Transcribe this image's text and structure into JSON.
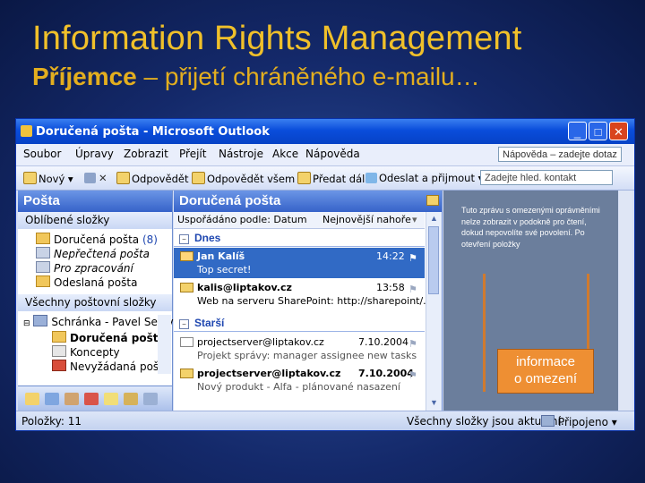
{
  "slide": {
    "title": "Information Rights Management",
    "subtitle_bold": "Příjemce",
    "subtitle_rest": " – přijetí chráněného e-mailu…"
  },
  "window": {
    "title": "Doručená pošta - Microsoft Outlook",
    "menu": [
      "Soubor",
      "Úpravy",
      "Zobrazit",
      "Přejít",
      "Nástroje",
      "Akce",
      "Nápověda"
    ],
    "help_placeholder": "Nápověda – zadejte dotaz",
    "toolbar": {
      "new": "Nový",
      "reply": "Odpovědět",
      "reply_all": "Odpovědět všem",
      "forward": "Předat dál",
      "send_receive": "Odeslat a přijmout",
      "search_placeholder": "Zadejte hled. kontakt"
    }
  },
  "nav": {
    "header": "Pošta",
    "favorites_header": "Oblíbené složky",
    "favorites": [
      {
        "label": "Doručená pošta",
        "count": "(8)"
      },
      {
        "label": "Nepřečtená pošta"
      },
      {
        "label": "Pro zpracování"
      },
      {
        "label": "Odeslaná pošta"
      }
    ],
    "all_header": "Všechny poštovní složky",
    "mailbox": "Schránka - Pavel Selav",
    "tree": [
      "Doručená pošta",
      "Koncepty",
      "Nevyžádaná pošta"
    ]
  },
  "list": {
    "header": "Doručená pošta",
    "sort_by": "Uspořádáno podle: Datum",
    "sort_order": "Nejnovější nahoře",
    "groups": [
      {
        "name": "Dnes",
        "messages": [
          {
            "sender": "Jan Kalíš",
            "time": "14:22",
            "subject": "Top secret!"
          },
          {
            "sender": "kalis@liptakov.cz",
            "time": "13:58",
            "subject": "Web na serveru SharePoint: http://sharepoint/..."
          }
        ]
      },
      {
        "name": "Starší",
        "messages": [
          {
            "sender": "projectserver@liptakov.cz",
            "time": "7.10.2004",
            "subject": "Projekt správy: manager assignee new tasks"
          },
          {
            "sender": "projectserver@liptakov.cz",
            "time": "7.10.2004",
            "subject": "Nový produkt - Alfa - plánované nasazení"
          }
        ]
      }
    ]
  },
  "reading_pane": {
    "text": "Tuto zprávu s omezenými oprávněními nelze zobrazit v podokně pro čtení, dokud nepovolíte své povolení. Po otevření položky"
  },
  "status": {
    "items": "Položky: 11",
    "sync": "Všechny složky jsou aktuální.",
    "connection": "Připojeno"
  },
  "callout": {
    "line1": "informace",
    "line2": "o omezení"
  },
  "colors": {
    "title": "#f0c02a",
    "callout": "#ee8f33",
    "selection": "#316ac5"
  }
}
